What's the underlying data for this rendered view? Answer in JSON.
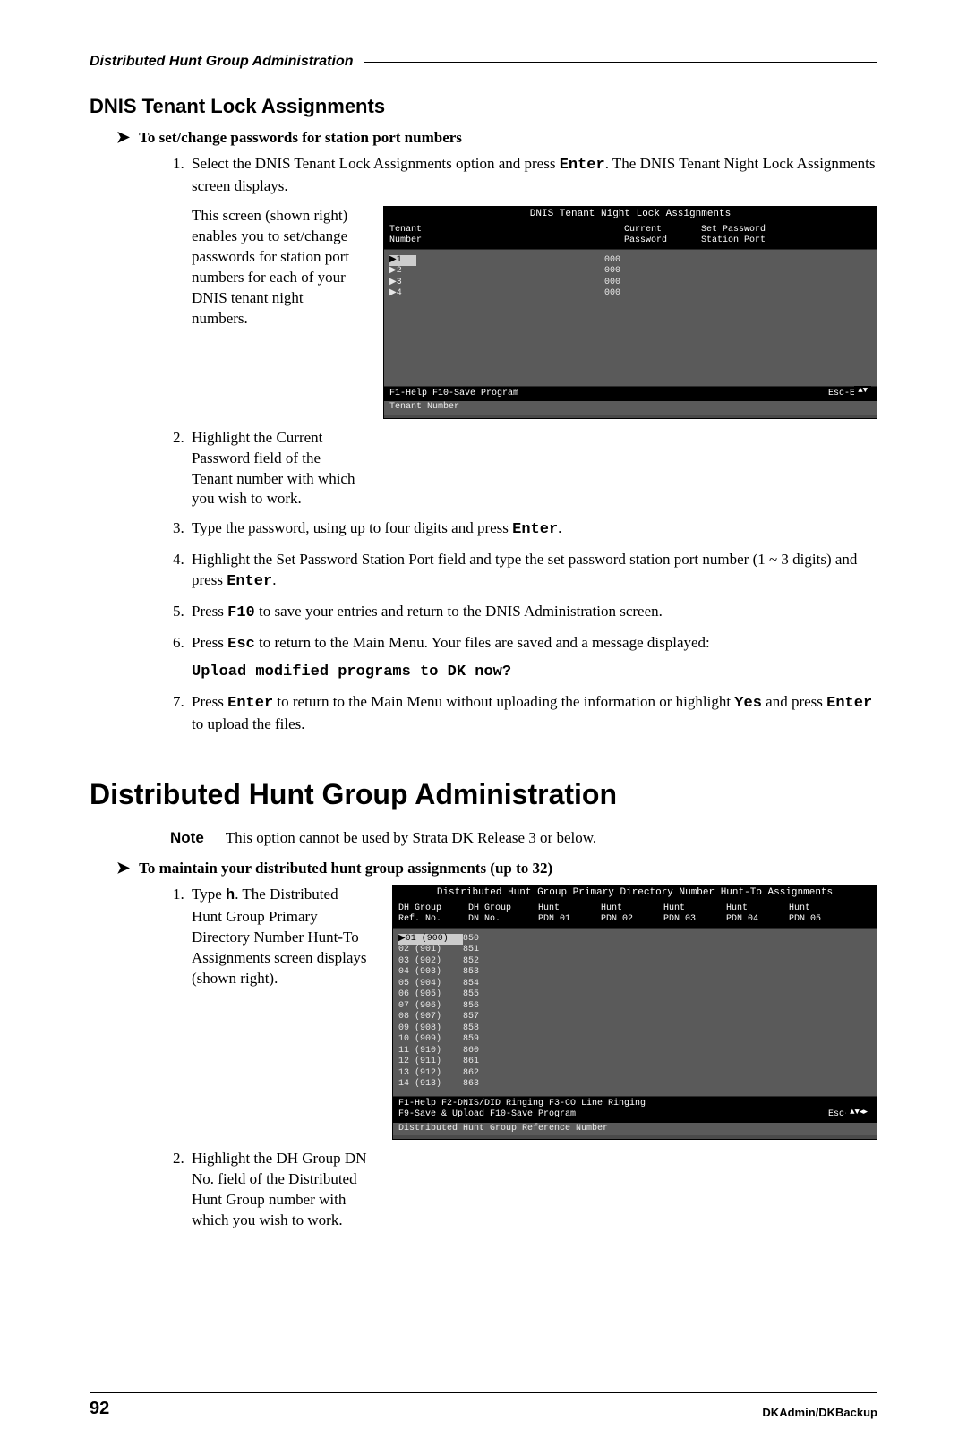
{
  "running_head": "Distributed Hunt Group Administration",
  "section1": {
    "title": "DNIS Tenant Lock Assignments",
    "procedure": "To set/change passwords for station port numbers",
    "steps": {
      "s1_a": "Select the DNIS Tenant Lock Assignments option and press ",
      "s1_b": ". The DNIS Tenant Night Lock Assignments screen displays.",
      "s1_side": "This screen (shown right) enables you to set/change passwords for station port numbers for each of your DNIS tenant night numbers.",
      "s2": "Highlight the Current Password field of the Tenant number with which you wish to work.",
      "s3_a": "Type the password, using up to four digits and press ",
      "s3_b": ".",
      "s4_a": "Highlight the Set Password Station Port field and type the set password station port number (1 ~ 3 digits) and press ",
      "s4_b": ".",
      "s5_a": "Press ",
      "s5_b": " to save your entries and return to the DNIS Administration screen.",
      "s6_a": "Press ",
      "s6_b": " to return to the Main Menu. Your files are saved and a message displayed:",
      "s6_msg": "Upload modified programs to DK now?",
      "s7_a": "Press ",
      "s7_b": " to return to the Main Menu without uploading the information or highlight ",
      "s7_c": " and press ",
      "s7_d": " to upload the files."
    },
    "keys": {
      "enter": "Enter",
      "f10": "F10",
      "esc": "Esc",
      "yes": "Yes"
    },
    "term": {
      "title": "DNIS Tenant Night Lock Assignments",
      "hdr1": "Tenant",
      "hdr1b": "Number",
      "hdr2": "Current",
      "hdr2b": "Password",
      "hdr3": "Set Password",
      "hdr3b": "Station Port",
      "rows": [
        {
          "n": "1",
          "p": "000"
        },
        {
          "n": "2",
          "p": "000"
        },
        {
          "n": "3",
          "p": "000"
        },
        {
          "n": "4",
          "p": "000"
        }
      ],
      "foot_left": "F1-Help  F10-Save Program",
      "foot_right": "Esc-Exit",
      "foot2": "Tenant Number",
      "scroll": "▲▼"
    }
  },
  "section2": {
    "title": "Distributed Hunt Group Administration",
    "note_label": "Note",
    "note_text": "This option cannot be used by Strata DK Release 3 or below.",
    "procedure": "To maintain your distributed hunt group assignments (up to 32)",
    "steps": {
      "s1_a": "Type ",
      "s1_key": "h",
      "s1_b": ". The Distributed Hunt Group Primary Directory Number Hunt-To Assignments screen displays (shown right).",
      "s2": "Highlight the DH Group DN No. field of the Distributed Hunt Group number with which you wish to work."
    },
    "term": {
      "title": "Distributed Hunt Group Primary Directory Number Hunt-To Assignments",
      "hdrA": "DH Group",
      "hdrAb": "Ref. No.",
      "hdrB": "DH Group",
      "hdrBb": "DN No.",
      "hcol": "Hunt",
      "hcol2": "PDN",
      "cols": [
        "01",
        "02",
        "03",
        "04",
        "05"
      ],
      "rows": [
        {
          "r": "01",
          "a": "(900)",
          "b": "850"
        },
        {
          "r": "02",
          "a": "(901)",
          "b": "851"
        },
        {
          "r": "03",
          "a": "(902)",
          "b": "852"
        },
        {
          "r": "04",
          "a": "(903)",
          "b": "853"
        },
        {
          "r": "05",
          "a": "(904)",
          "b": "854"
        },
        {
          "r": "06",
          "a": "(905)",
          "b": "855"
        },
        {
          "r": "07",
          "a": "(906)",
          "b": "856"
        },
        {
          "r": "08",
          "a": "(907)",
          "b": "857"
        },
        {
          "r": "09",
          "a": "(908)",
          "b": "858"
        },
        {
          "r": "10",
          "a": "(909)",
          "b": "859"
        },
        {
          "r": "11",
          "a": "(910)",
          "b": "860"
        },
        {
          "r": "12",
          "a": "(911)",
          "b": "861"
        },
        {
          "r": "13",
          "a": "(912)",
          "b": "862"
        },
        {
          "r": "14",
          "a": "(913)",
          "b": "863"
        }
      ],
      "foot_l1": "F1-Help  F2-DNIS/DID Ringing  F3-CO Line Ringing",
      "foot_l2": "F9-Save & Upload  F10-Save Program",
      "foot_right": "Esc-Exit",
      "foot2": "Distributed Hunt Group Reference Number",
      "scroll": "▲▼◂▸"
    }
  },
  "footer": {
    "page": "92",
    "right": "DKAdmin/DKBackup"
  }
}
